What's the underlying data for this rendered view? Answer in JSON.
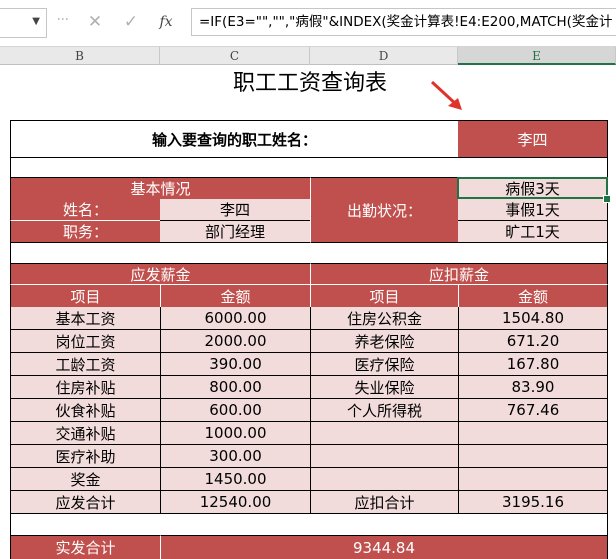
{
  "formula_bar": {
    "fx_symbol": "fx",
    "cancel_symbol": "✕",
    "enter_symbol": "✓",
    "formula": "=IF(E3=\"\",\"\",\"病假\"&INDEX(奖金计算表!E4:E200,MATCH(奖金计"
  },
  "columns": [
    "B",
    "C",
    "D",
    "E"
  ],
  "title": "职工工资查询表",
  "query": {
    "label": "输入要查询的职工姓名：",
    "value": "李四"
  },
  "basic": {
    "header": "基本情况",
    "name_label": "姓名：",
    "name_value": "李四",
    "position_label": "职务：",
    "position_value": "部门经理",
    "attendance_label": "出勤状况：",
    "attendance": [
      "病假3天",
      "事假1天",
      "旷工1天"
    ]
  },
  "salary": {
    "payable_header": "应发薪金",
    "deduction_header": "应扣薪金",
    "col_item": "项目",
    "col_amount": "金额",
    "payable": [
      {
        "item": "基本工资",
        "amount": "6000.00"
      },
      {
        "item": "岗位工资",
        "amount": "2000.00"
      },
      {
        "item": "工龄工资",
        "amount": "390.00"
      },
      {
        "item": "住房补贴",
        "amount": "800.00"
      },
      {
        "item": "伙食补贴",
        "amount": "600.00"
      },
      {
        "item": "交通补贴",
        "amount": "1000.00"
      },
      {
        "item": "医疗补助",
        "amount": "300.00"
      },
      {
        "item": "奖金",
        "amount": "1450.00"
      },
      {
        "item": "应发合计",
        "amount": "12540.00"
      }
    ],
    "deductions": [
      {
        "item": "住房公积金",
        "amount": "1504.80"
      },
      {
        "item": "养老保险",
        "amount": "671.20"
      },
      {
        "item": "医疗保险",
        "amount": "167.80"
      },
      {
        "item": "失业保险",
        "amount": "83.90"
      },
      {
        "item": "个人所得税",
        "amount": "767.46"
      },
      {
        "item": "",
        "amount": ""
      },
      {
        "item": "",
        "amount": ""
      },
      {
        "item": "",
        "amount": ""
      },
      {
        "item": "应扣合计",
        "amount": "3195.16"
      }
    ],
    "net_label": "实发合计",
    "net_value": "9344.84"
  },
  "colors": {
    "header_red": "#c0504d",
    "cell_pink": "#f2dcdb",
    "excel_green": "#217346"
  }
}
